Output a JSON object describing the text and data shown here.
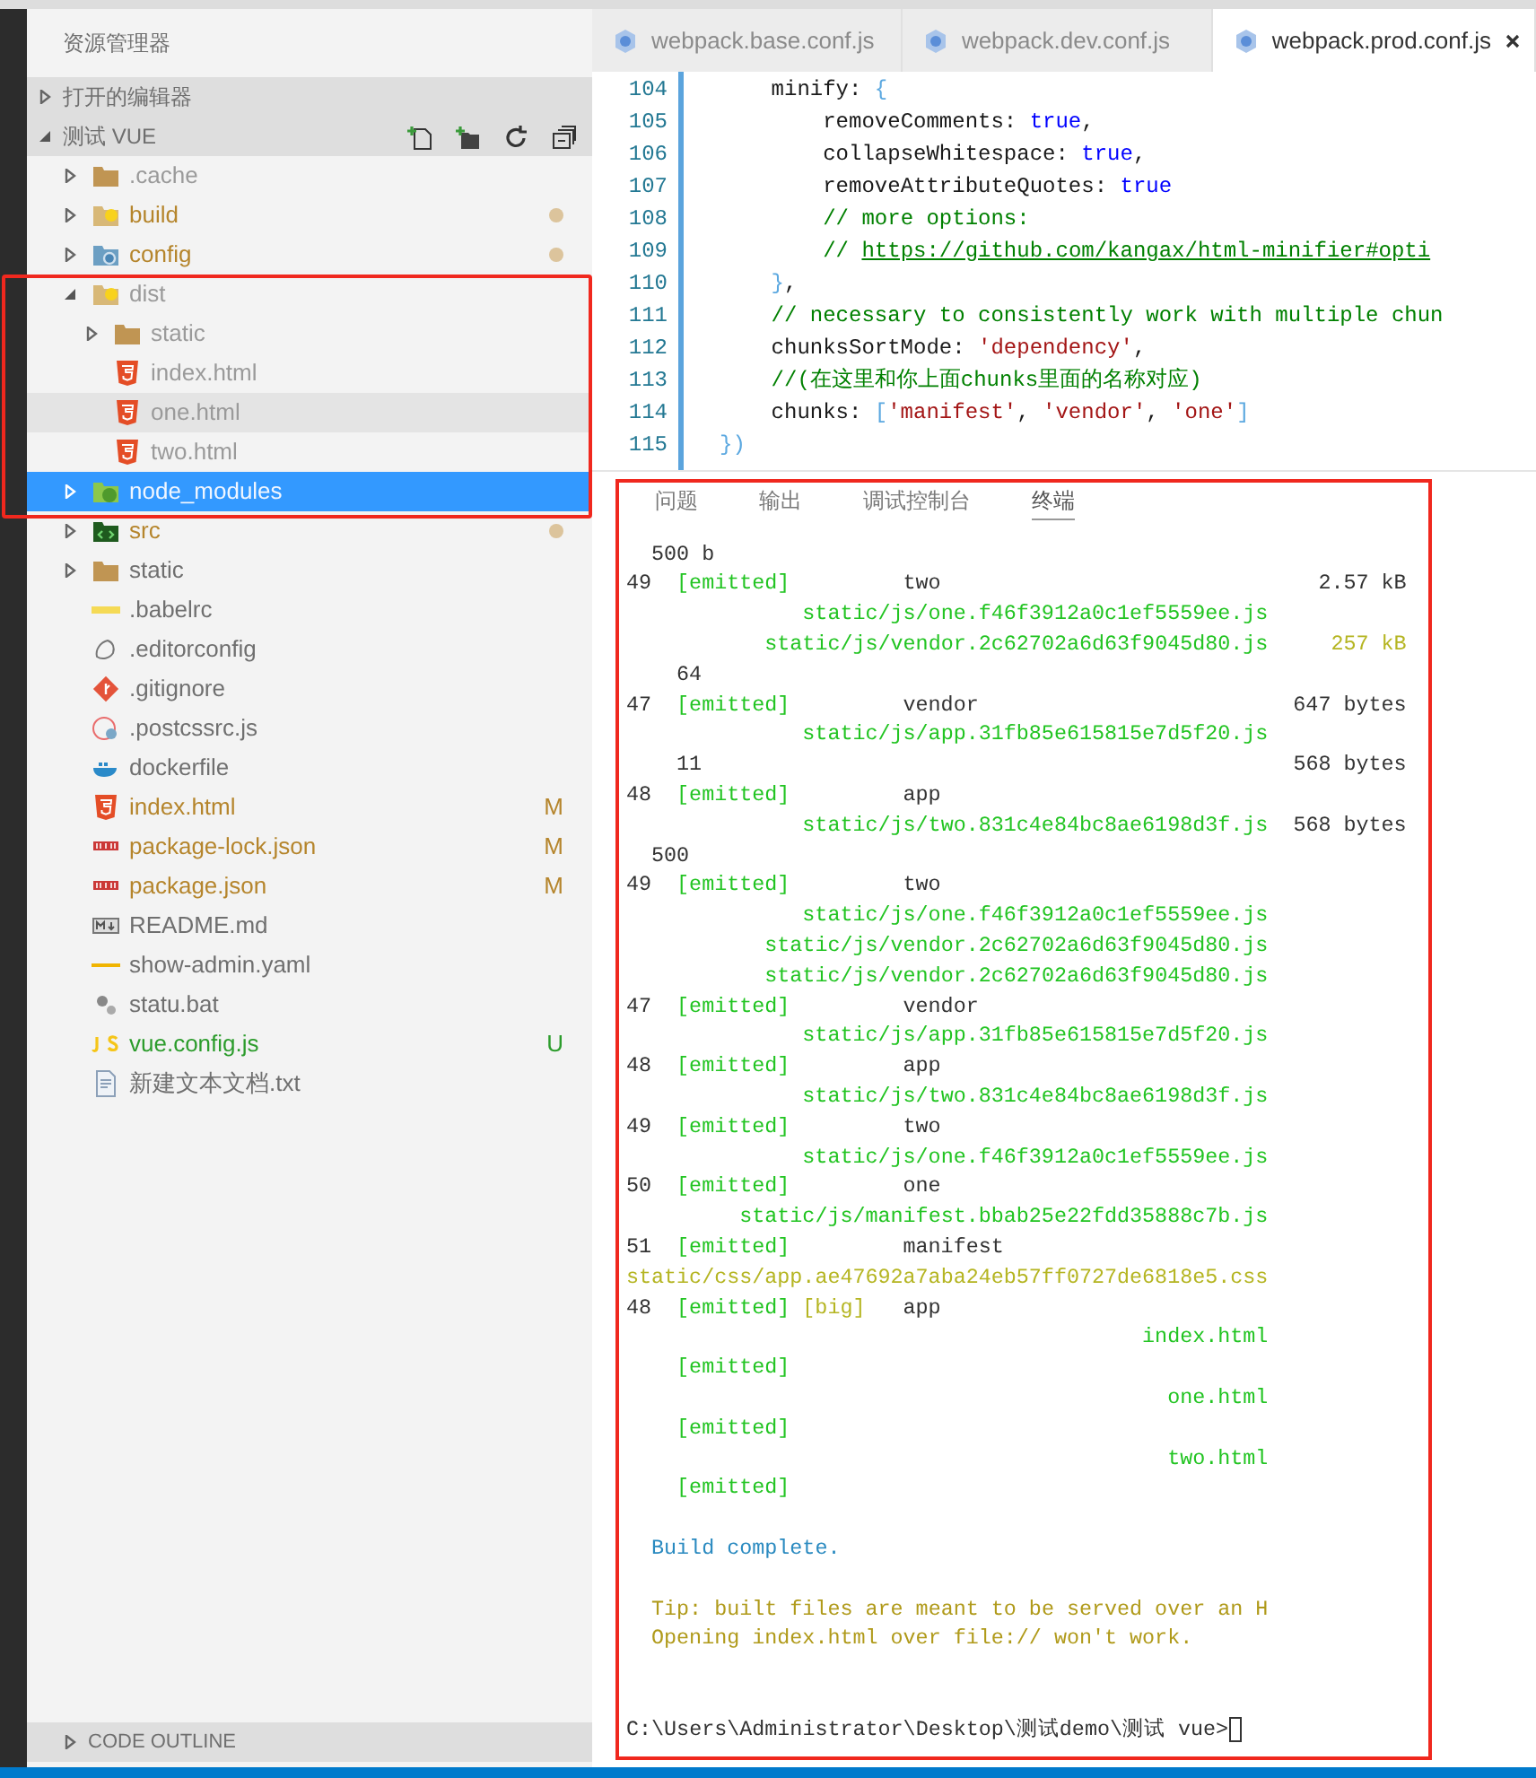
{
  "sidebar": {
    "title": "资源管理器",
    "sections": [
      {
        "label": "打开的编辑器",
        "expanded": false
      },
      {
        "label": "测试 VUE",
        "expanded": true
      }
    ],
    "tree": [
      {
        "name": ".cache",
        "kind": "folder",
        "expanded": false,
        "selected": false,
        "ignored": true
      },
      {
        "name": "build",
        "kind": "folder-build",
        "expanded": false,
        "selected": false,
        "ignored": false,
        "dot": true
      },
      {
        "name": "config",
        "kind": "folder-config",
        "expanded": false,
        "selected": false,
        "ignored": false,
        "dot": true
      },
      {
        "name": "dist",
        "kind": "folder-build",
        "expanded": true,
        "selected": false,
        "ignored": true,
        "framed": true,
        "children": [
          {
            "name": "static",
            "kind": "folder",
            "expanded": false,
            "selected": false,
            "ignored": true
          },
          {
            "name": "index.html",
            "kind": "html",
            "selected": false,
            "ignored": true
          },
          {
            "name": "one.html",
            "kind": "html",
            "selected": true,
            "ignored": true
          },
          {
            "name": "two.html",
            "kind": "html",
            "selected": false,
            "ignored": true
          }
        ]
      },
      {
        "name": "node_modules",
        "kind": "folder-node",
        "expanded": false,
        "selected": true,
        "ignored": true,
        "framed": true
      },
      {
        "name": "src",
        "kind": "folder-src",
        "expanded": false,
        "selected": false,
        "ignored": false,
        "dot": true
      },
      {
        "name": "static",
        "kind": "folder",
        "expanded": false,
        "selected": false,
        "ignored": false
      },
      {
        "name": ".babelrc",
        "kind": "babel",
        "selected": false,
        "ignored": false
      },
      {
        "name": ".editorconfig",
        "kind": "editorconfig",
        "selected": false,
        "ignored": false
      },
      {
        "name": ".gitignore",
        "kind": "git",
        "selected": false,
        "ignored": false
      },
      {
        "name": ".postcssrc.js",
        "kind": "postcss",
        "selected": false,
        "ignored": false
      },
      {
        "name": "dockerfile",
        "kind": "docker",
        "selected": false,
        "ignored": false
      },
      {
        "name": "index.html",
        "kind": "html",
        "selected": false,
        "ignored": false,
        "badge": {
          "text": "M",
          "kind": "modified"
        }
      },
      {
        "name": "package-lock.json",
        "kind": "npm",
        "selected": false,
        "ignored": false,
        "badge": {
          "text": "M",
          "kind": "modified"
        }
      },
      {
        "name": "package.json",
        "kind": "npm",
        "selected": false,
        "ignored": false,
        "badge": {
          "text": "M",
          "kind": "modified"
        }
      },
      {
        "name": "README.md",
        "kind": "markdown",
        "selected": false,
        "ignored": false
      },
      {
        "name": "show-admin.yaml",
        "kind": "yaml",
        "selected": false,
        "ignored": false
      },
      {
        "name": "statu.bat",
        "kind": "gears",
        "selected": false,
        "ignored": false
      },
      {
        "name": "vue.config.js",
        "kind": "js",
        "selected": false,
        "ignored": false,
        "badge": {
          "text": "U",
          "kind": "untracked"
        }
      },
      {
        "name": "新建文本文档.txt",
        "kind": "text",
        "selected": false,
        "ignored": false
      }
    ],
    "outline": {
      "label": "CODE OUTLINE",
      "expanded": false
    }
  },
  "editor": {
    "tabs": [
      {
        "label": "webpack.base.conf.js",
        "selected": false
      },
      {
        "label": "webpack.dev.conf.js",
        "selected": false
      },
      {
        "label": "webpack.prod.conf.js",
        "selected": true
      }
    ],
    "lines": [
      {
        "children": [
          {
            "number": "104",
            "tokens": [
              {
                "kind": "plain",
                "text": "minify: "
              },
              {
                "kind": "brace",
                "text": "{"
              }
            ],
            "children": [
              {
                "number": "105",
                "tokens": [
                  {
                    "kind": "plain",
                    "text": "removeComments: "
                  },
                  {
                    "kind": "keyword",
                    "text": "true"
                  },
                  {
                    "kind": "plain",
                    "text": ","
                  }
                ]
              },
              {
                "number": "106",
                "tokens": [
                  {
                    "kind": "plain",
                    "text": "collapseWhitespace: "
                  },
                  {
                    "kind": "keyword",
                    "text": "true"
                  },
                  {
                    "kind": "plain",
                    "text": ","
                  }
                ]
              },
              {
                "number": "107",
                "tokens": [
                  {
                    "kind": "plain",
                    "text": "removeAttributeQuotes: "
                  },
                  {
                    "kind": "keyword",
                    "text": "true"
                  }
                ]
              },
              {
                "number": "108",
                "tokens": [
                  {
                    "kind": "comment",
                    "text": "// more options:"
                  }
                ]
              },
              {
                "number": "109",
                "tokens": [
                  {
                    "kind": "comment",
                    "text": "// "
                  },
                  {
                    "kind": "link",
                    "text": "https://github.com/kangax/html-minifier#opti"
                  }
                ]
              }
            ]
          },
          {
            "number": "110",
            "tokens": [
              {
                "kind": "brace",
                "text": "}"
              },
              {
                "kind": "plain",
                "text": ","
              }
            ]
          },
          {
            "number": "111",
            "tokens": [
              {
                "kind": "comment",
                "text": "// necessary to consistently work with multiple chun"
              }
            ]
          },
          {
            "number": "112",
            "tokens": [
              {
                "kind": "plain",
                "text": "chunksSortMode: "
              },
              {
                "kind": "string",
                "text": "'dependency'"
              },
              {
                "kind": "plain",
                "text": ","
              }
            ]
          },
          {
            "number": "113",
            "tokens": [
              {
                "kind": "comment",
                "text": "//(在这里和你上面chunks里面的名称对应)"
              }
            ]
          },
          {
            "number": "114",
            "tokens": [
              {
                "kind": "plain",
                "text": "chunks: "
              },
              {
                "kind": "brace",
                "text": "["
              },
              {
                "kind": "string",
                "text": "'manifest'"
              },
              {
                "kind": "plain",
                "text": ", "
              },
              {
                "kind": "string",
                "text": "'vendor'"
              },
              {
                "kind": "plain",
                "text": ", "
              },
              {
                "kind": "string",
                "text": "'one'"
              },
              {
                "kind": "brace",
                "text": "]"
              }
            ]
          }
        ]
      },
      {
        "number": "115",
        "tokens": [
          {
            "kind": "brace",
            "text": "})"
          }
        ]
      }
    ]
  },
  "panel": {
    "framed": true,
    "tabs": [
      {
        "label": "问题",
        "selected": false
      },
      {
        "label": "输出",
        "selected": false
      },
      {
        "label": "调试控制台",
        "selected": false
      },
      {
        "label": "终端",
        "selected": true
      }
    ],
    "terminal": [
      {
        "kind": "fragment",
        "text": "500 b"
      },
      {
        "kind": "chunk",
        "id": "49",
        "status": "[emitted]",
        "name": "two",
        "size": "2.57 kB"
      },
      {
        "kind": "asset",
        "path": "static/js/one.f46f3912a0c1ef5559ee.js"
      },
      {
        "kind": "asset",
        "path": "static/js/vendor.2c62702a6d63f9045d80.js",
        "size": "257 kB",
        "size_big": true
      },
      {
        "kind": "count",
        "text": "64"
      },
      {
        "kind": "chunk",
        "id": "47",
        "status": "[emitted]",
        "name": "vendor",
        "size": "647 bytes"
      },
      {
        "kind": "asset",
        "path": "static/js/app.31fb85e615815e7d5f20.js"
      },
      {
        "kind": "count",
        "text": "11",
        "size": "568 bytes"
      },
      {
        "kind": "chunk",
        "id": "48",
        "status": "[emitted]",
        "name": "app"
      },
      {
        "kind": "asset",
        "path": "static/js/two.831c4e84bc8ae6198d3f.js",
        "size": "568 bytes",
        "size_big": false
      },
      {
        "kind": "fragment",
        "text": "500"
      },
      {
        "kind": "chunk",
        "id": "49",
        "status": "[emitted]",
        "name": "two"
      },
      {
        "kind": "asset",
        "path": "static/js/one.f46f3912a0c1ef5559ee.js"
      },
      {
        "kind": "asset",
        "path": "static/js/vendor.2c62702a6d63f9045d80.js"
      },
      {
        "kind": "asset",
        "path": "static/js/vendor.2c62702a6d63f9045d80.js"
      },
      {
        "kind": "chunk",
        "id": "47",
        "status": "[emitted]",
        "name": "vendor"
      },
      {
        "kind": "asset",
        "path": "static/js/app.31fb85e615815e7d5f20.js"
      },
      {
        "kind": "chunk",
        "id": "48",
        "status": "[emitted]",
        "name": "app"
      },
      {
        "kind": "asset",
        "path": "static/js/two.831c4e84bc8ae6198d3f.js"
      },
      {
        "kind": "chunk",
        "id": "49",
        "status": "[emitted]",
        "name": "two"
      },
      {
        "kind": "asset",
        "path": "static/js/one.f46f3912a0c1ef5559ee.js"
      },
      {
        "kind": "chunk",
        "id": "50",
        "status": "[emitted]",
        "name": "one"
      },
      {
        "kind": "asset",
        "path": "static/js/manifest.bbab25e22fdd35888c7b.js"
      },
      {
        "kind": "chunk",
        "id": "51",
        "status": "[emitted]",
        "name": "manifest"
      },
      {
        "kind": "asset",
        "path": "static/css/app.ae47692a7aba24eb57ff0727de6818e5.css",
        "path_big": true
      },
      {
        "kind": "chunk",
        "id": "48",
        "status": "[emitted]",
        "flag": "[big]",
        "name": "app"
      },
      {
        "kind": "asset",
        "path": "index.html"
      },
      {
        "kind": "chunk",
        "status": "[emitted]"
      },
      {
        "kind": "asset",
        "path": "one.html"
      },
      {
        "kind": "chunk",
        "status": "[emitted]"
      },
      {
        "kind": "asset",
        "path": "two.html"
      },
      {
        "kind": "chunk",
        "status": "[emitted]"
      },
      {
        "kind": "blank"
      },
      {
        "kind": "info",
        "text": "Build complete."
      },
      {
        "kind": "blank"
      },
      {
        "kind": "tip",
        "text": "Tip: built files are meant to be served over an H"
      },
      {
        "kind": "tip",
        "text": "Opening index.html over file:// won't work."
      },
      {
        "kind": "blank"
      },
      {
        "kind": "blank"
      },
      {
        "kind": "prompt",
        "text": "C:\\Users\\Administrator\\Desktop\\测试demo\\测试 vue>"
      }
    ]
  }
}
